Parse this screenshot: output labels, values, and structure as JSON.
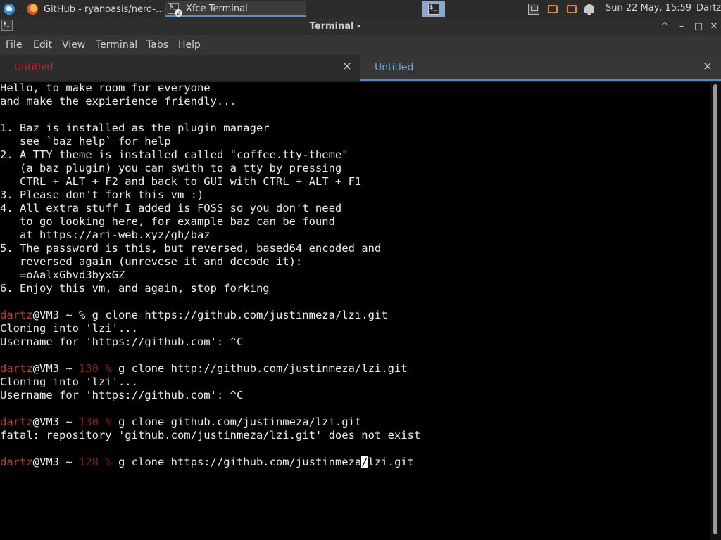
{
  "panel": {
    "browser_task": "GitHub - ryanoasis/nerd-...",
    "terminal_task": "Xfce Terminal",
    "terminal_task_badge": "2",
    "term_icon_glyph": "$_",
    "clock": "Sun 22 May, 15:59",
    "user": "Dartz"
  },
  "window": {
    "title": "Terminal -",
    "shade": "^",
    "minimize": "–",
    "maximize": "□",
    "close": "✕"
  },
  "menu": {
    "file": "File",
    "edit": "Edit",
    "view": "View",
    "terminal": "Terminal",
    "tabs": "Tabs",
    "help": "Help"
  },
  "tabs": [
    {
      "label": "Untitled",
      "close": "×"
    },
    {
      "label": "Untitled",
      "close": "×"
    }
  ],
  "terminal": {
    "intro": [
      "Hello, to make room for everyone",
      "and make the expierience friendly...",
      "",
      "1. Baz is installed as the plugin manager",
      "   see `baz help` for help",
      "2. A TTY theme is installed called \"coffee.tty-theme\"",
      "   (a baz plugin) you can swith to a tty by pressing",
      "   CTRL + ALT + F2 and back to GUI with CTRL + ALT + F1",
      "3. Please don't fork this vm :)",
      "4. All extra stuff I added is FOSS so you don't need",
      "   to go looking here, for example baz can be found",
      "   at https://ari-web.xyz/gh/baz",
      "5. The password is this, but reversed, based64 encoded and",
      "   reversed again (unrevese it and decode it):",
      "   =oAalxGbvd3byxGZ",
      "6. Enjoy this vm, and again, stop forking",
      ""
    ],
    "prompt_user": "dartz",
    "prompt_host": "@VM3 ~ ",
    "cmd1": {
      "status": "",
      "command": "g clone https://github.com/justinmeza/lzi.git"
    },
    "out1": [
      "Cloning into 'lzi'...",
      "Username for 'https://github.com': ^C",
      ""
    ],
    "cmd2": {
      "status": "130",
      "command": "g clone http://github.com/justinmeza/lzi.git"
    },
    "out2": [
      "Cloning into 'lzi'...",
      "Username for 'https://github.com': ^C",
      ""
    ],
    "cmd3": {
      "status": "130",
      "command": "g clone github.com/justinmeza/lzi.git"
    },
    "out3": [
      "fatal: repository 'github.com/justinmeza/lzi.git' does not exist",
      ""
    ],
    "cmd4": {
      "status": "128",
      "command_before_cursor": "g clone https://github.com/justinmeza",
      "cursor_char": "/",
      "command_after_cursor": "lzi.git"
    }
  },
  "colors": {
    "username": "#c43a3a",
    "error_status": "#8a1e1e",
    "active_tab_accent": "#4a8ad6",
    "inactive_tab_label": "#c0262b"
  },
  "icons": [
    "xfce-menu-icon",
    "firefox-icon",
    "terminal-icon",
    "network-icon",
    "notification-icon",
    "bell-icon"
  ]
}
